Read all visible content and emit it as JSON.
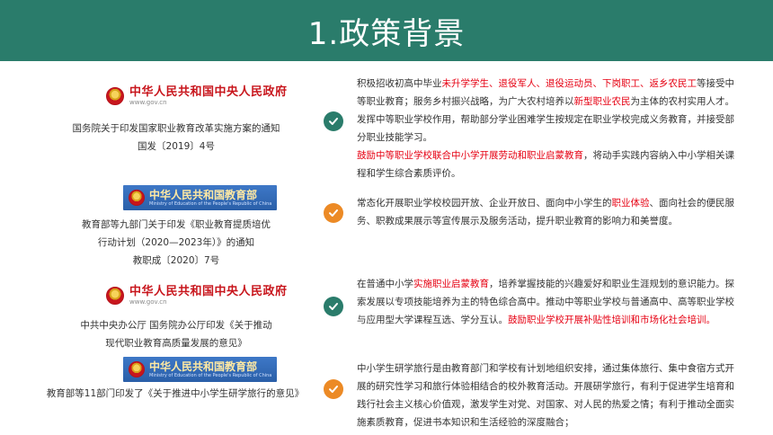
{
  "header": {
    "title": "1.政策背景"
  },
  "logos": {
    "gov_name": "中华人民共和国中央人民政府",
    "gov_url": "www.gov.cn",
    "moe_name": "中华人民共和国教育部",
    "moe_en": "Ministry of Education of the People's Republic of China"
  },
  "left": {
    "item1": {
      "line1": "国务院关于印发国家职业教育改革实施方案的通知",
      "line2": "国发〔2019〕4号"
    },
    "item2": {
      "line1": "教育部等九部门关于印发《职业教育提质培优",
      "line2": "行动计划（2020—2023年）》的通知",
      "line3": "教职成〔2020〕7号"
    },
    "item3": {
      "line1": "中共中央办公厅 国务院办公厅印发《关于推动",
      "line2": "现代职业教育高质量发展的意见》"
    },
    "item4": {
      "line1": "教育部等11部门印发了《关于推进中小学生研学旅行的意见》"
    }
  },
  "right": {
    "p1": {
      "a": "积极招收初高中毕业",
      "b": "未升学学生、退役军人、退役运动员、下岗职工、返乡农民工",
      "c": "等接受中等职业教育；服务乡村振兴战略，为广大农村培养以",
      "d": "新型职业农民",
      "e": "为主体的农村实用人才。发挥中等职业学校作用，帮助部分学业困难学生按规定在职业学校完成义务教育，并接受部分职业技能学习。",
      "f": "鼓励中等职业学校联合中小学开展劳动和职业启蒙教育",
      "g": "，将动手实践内容纳入中小学相关课程和学生综合素质评价。"
    },
    "p2": {
      "a": "常态化开展职业学校校园开放、企业开放日、面向中小学生的",
      "b": "职业体验",
      "c": "、面向社会的便民服务、职教成果展示等宣传展示及服务活动，提升职业教育的影响力和美誉度。"
    },
    "p3": {
      "a": "在普通中小学",
      "b": "实施职业启蒙教育",
      "c": "，培养掌握技能的兴趣爱好和职业生涯规划的意识能力。探索发展以专项技能培养为主的特色综合高中。推动中等职业学校与普通高中、高等职业学校与应用型大学课程互选、学分互认。",
      "d": "鼓励职业学校开展补贴性培训和市场化社会培训。"
    },
    "p4": {
      "a": "中小学生研学旅行是由教育部门和学校有计划地组织安排，通过集体旅行、集中食宿方式开展的研究性学习和旅行体验相结合的校外教育活动。开展研学旅行，有利于促进学生培育和践行社会主义核心价值观，激发学生对党、对国家、对人民的热爱之情；有利于推动全面实施素质教育，促进书本知识和生活经验的深度融合；"
    }
  },
  "colors": {
    "header_bg": "#2a7c6b",
    "check_green": "#2a7c6b",
    "check_orange": "#ec8a25",
    "highlight_red": "#e60012"
  },
  "icons": {
    "check": "check-circle-icon",
    "emblem": "national-emblem-icon"
  }
}
